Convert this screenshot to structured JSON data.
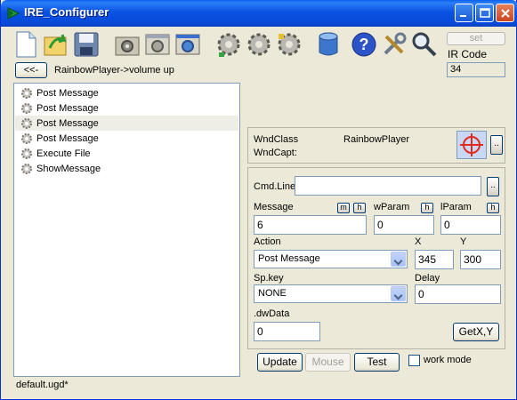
{
  "window": {
    "title": "IRE_Configurer"
  },
  "toolbar": {
    "icons": [
      "new-file-icon",
      "open-icon",
      "save-icon",
      "folder-gear-icon",
      "gear-window-icon",
      "gear-window-blue-icon",
      "gear-green-icon",
      "gear-double-icon",
      "gear-yellow-icon",
      "database-icon",
      "help-icon",
      "tools-icon",
      "search-icon"
    ],
    "set_label": "set",
    "ir_code_label": "IR Code",
    "ir_code_value": "34"
  },
  "nav": {
    "back_label": "<<-",
    "breadcrumb": "RainbowPlayer->volume up"
  },
  "actions_list": {
    "items": [
      {
        "label": "Post Message",
        "selected": false
      },
      {
        "label": "Post Message",
        "selected": false
      },
      {
        "label": "Post Message",
        "selected": true
      },
      {
        "label": "Post Message",
        "selected": false
      },
      {
        "label": "Execute File",
        "selected": false
      },
      {
        "label": "ShowMessage",
        "selected": false
      }
    ]
  },
  "window_target": {
    "wnd_class_label": "WndClass",
    "wnd_class_value": "RainbowPlayer",
    "wnd_capt_label": "WndCapt:",
    "wnd_capt_value": "",
    "more_label": ".."
  },
  "details": {
    "cmd_line_label": "Cmd.Line",
    "cmd_line_value": "",
    "cmd_more": "..",
    "message_label": "Message",
    "message_value": "6",
    "m_btn": "m",
    "h_btn": "h",
    "wparam_label": "wParam",
    "wparam_value": "0",
    "lparam_label": "lParam",
    "lparam_value": "0",
    "action_label": "Action",
    "action_value": "Post Message",
    "x_label": "X",
    "x_value": "345",
    "y_label": "Y",
    "y_value": "300",
    "spkey_label": "Sp.key",
    "spkey_value": "NONE",
    "delay_label": "Delay",
    "delay_value": "0",
    "dwdata_label": ".dwData",
    "dwdata_value": "0",
    "getxy_label": "GetX,Y"
  },
  "footer": {
    "update_label": "Update",
    "mouse_label": "Mouse",
    "test_label": "Test",
    "work_mode_label": "work mode",
    "work_mode_checked": false,
    "status_file": "default.ugd*"
  }
}
